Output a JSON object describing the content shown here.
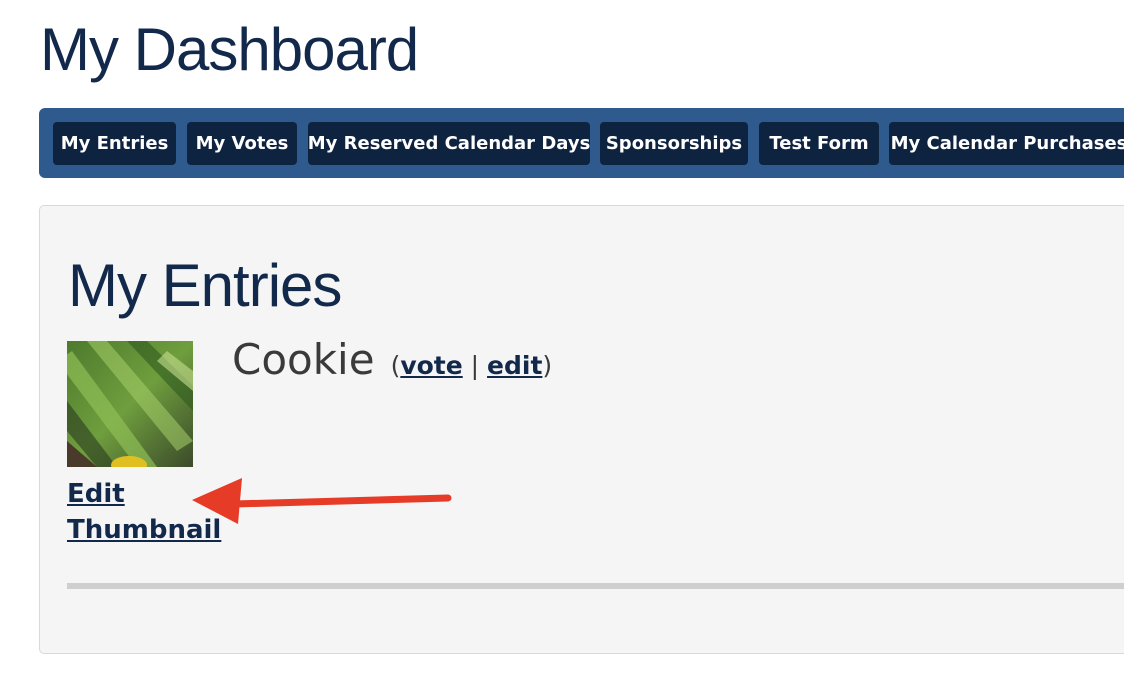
{
  "page": {
    "title": "My Dashboard"
  },
  "nav": {
    "items": [
      {
        "label": "My Entries"
      },
      {
        "label": "My Votes"
      },
      {
        "label": "My Reserved Calendar Days"
      },
      {
        "label": "Sponsorships"
      },
      {
        "label": "Test Form"
      },
      {
        "label": "My Calendar Purchases"
      }
    ]
  },
  "section": {
    "title": "My Entries"
  },
  "entry": {
    "name": "Cookie",
    "open_paren": "(",
    "vote_label": "vote",
    "separator": " | ",
    "edit_label": "edit",
    "close_paren": ")",
    "thumbnail_link_line1": "Edit",
    "thumbnail_link_line2": "Thumbnail"
  },
  "colors": {
    "title": "#13294b",
    "nav_bar": "#2f5a8d",
    "nav_item": "#0e2340",
    "annotation_arrow": "#e63b26"
  }
}
